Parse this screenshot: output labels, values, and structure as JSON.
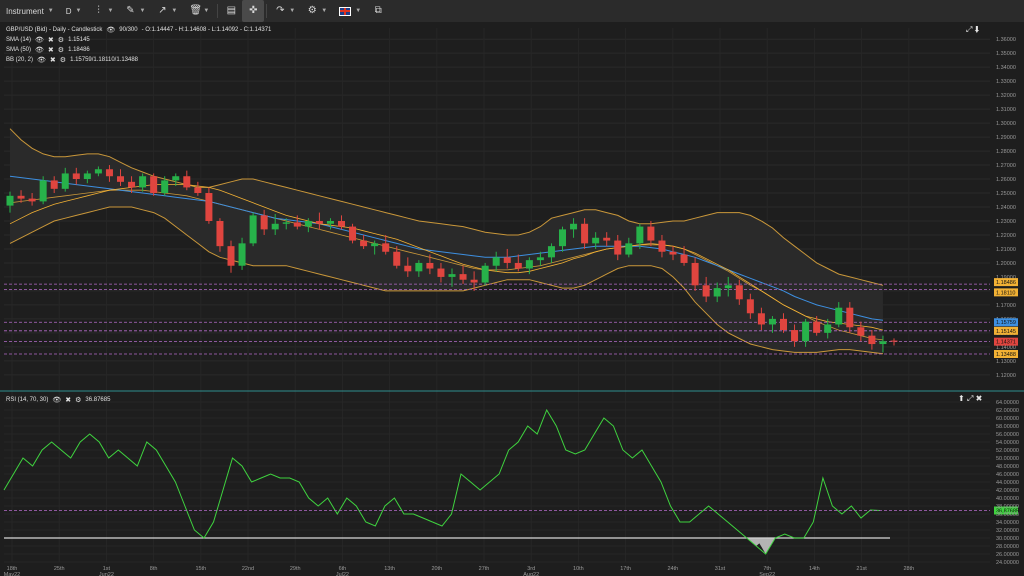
{
  "toolbar": {
    "instrument_label": "Instrument",
    "period_label": "D",
    "flag_icon": "uk-flag-icon"
  },
  "legend": {
    "title": "GBP/USD (Bid) - Daily - Candlestick",
    "candles_count": "90/300",
    "ohlc": "- O:1.14447 - H:1.14608 - L:1.14092 - C:1.14371",
    "sma14_label": "SMA (14)",
    "sma14_value": "1.15145",
    "sma50_label": "SMA (50)",
    "sma50_value": "1.18486",
    "bb_label": "BB (20, 2)",
    "bb_value": "1.15759/1.18110/1.13488",
    "rsi_label": "RSI (14, 70, 30)",
    "rsi_value": "36.87685"
  },
  "colors": {
    "bull": "#27b24a",
    "bear": "#e0453f",
    "sma14": "#f2b134",
    "sma50": "#3d8fe0",
    "bb": "#c9973a",
    "rsi": "#3fd33f",
    "background": "#1e1e1e"
  },
  "chart_data": [
    {
      "type": "candlestick",
      "x_labels": [
        "18th May22",
        "25th",
        "1st Jun22",
        "8th",
        "15th",
        "22nd",
        "29th",
        "6th Jul22",
        "13th",
        "20th",
        "27th",
        "3rd Aug22",
        "10th",
        "17th",
        "24th",
        "31st",
        "7th Sep22",
        "14th",
        "21st",
        "28th"
      ],
      "y_ticks": [
        "1.36000",
        "1.35000",
        "1.34000",
        "1.33000",
        "1.32000",
        "1.31000",
        "1.30000",
        "1.29000",
        "1.28000",
        "1.27000",
        "1.26000",
        "1.25000",
        "1.24000",
        "1.23000",
        "1.22000",
        "1.21000",
        "1.20000",
        "1.19000",
        "1.18000",
        "1.17000",
        "1.16000",
        "1.15000",
        "1.14000",
        "1.13000",
        "1.12000"
      ],
      "ylim": [
        1.112,
        1.368
      ],
      "price_tags": [
        {
          "label": "1.18486",
          "color": "#f2b134"
        },
        {
          "label": "1.18110",
          "color": "#f2b134"
        },
        {
          "label": "1.15759",
          "color": "#3d8fe0"
        },
        {
          "label": "1.15145",
          "color": "#f2b134"
        },
        {
          "label": "1.14371",
          "color": "#e0453f"
        },
        {
          "label": "1.13488",
          "color": "#f2b134"
        }
      ],
      "horizontal_levels": [
        1.18486,
        1.1811,
        1.15759,
        1.15145,
        1.14371,
        1.13488
      ],
      "candles": [
        [
          1.241,
          1.251,
          1.236,
          1.248
        ],
        [
          1.248,
          1.252,
          1.243,
          1.246
        ],
        [
          1.246,
          1.25,
          1.241,
          1.244
        ],
        [
          1.244,
          1.262,
          1.242,
          1.259
        ],
        [
          1.259,
          1.262,
          1.25,
          1.253
        ],
        [
          1.253,
          1.268,
          1.251,
          1.264
        ],
        [
          1.264,
          1.268,
          1.256,
          1.26
        ],
        [
          1.26,
          1.266,
          1.257,
          1.264
        ],
        [
          1.264,
          1.269,
          1.262,
          1.267
        ],
        [
          1.267,
          1.27,
          1.258,
          1.262
        ],
        [
          1.262,
          1.267,
          1.255,
          1.258
        ],
        [
          1.258,
          1.262,
          1.25,
          1.254
        ],
        [
          1.254,
          1.264,
          1.251,
          1.262
        ],
        [
          1.262,
          1.264,
          1.248,
          1.25
        ],
        [
          1.25,
          1.262,
          1.248,
          1.259
        ],
        [
          1.259,
          1.264,
          1.255,
          1.262
        ],
        [
          1.262,
          1.266,
          1.252,
          1.254
        ],
        [
          1.254,
          1.258,
          1.248,
          1.25
        ],
        [
          1.25,
          1.254,
          1.228,
          1.23
        ],
        [
          1.23,
          1.232,
          1.208,
          1.212
        ],
        [
          1.212,
          1.216,
          1.193,
          1.198
        ],
        [
          1.198,
          1.218,
          1.195,
          1.214
        ],
        [
          1.214,
          1.236,
          1.212,
          1.234
        ],
        [
          1.234,
          1.238,
          1.22,
          1.224
        ],
        [
          1.224,
          1.235,
          1.22,
          1.228
        ],
        [
          1.228,
          1.232,
          1.224,
          1.229
        ],
        [
          1.229,
          1.234,
          1.224,
          1.226
        ],
        [
          1.226,
          1.232,
          1.222,
          1.23
        ],
        [
          1.23,
          1.236,
          1.224,
          1.228
        ],
        [
          1.228,
          1.232,
          1.224,
          1.23
        ],
        [
          1.23,
          1.234,
          1.224,
          1.226
        ],
        [
          1.226,
          1.228,
          1.214,
          1.216
        ],
        [
          1.216,
          1.22,
          1.21,
          1.212
        ],
        [
          1.212,
          1.216,
          1.206,
          1.214
        ],
        [
          1.214,
          1.22,
          1.206,
          1.208
        ],
        [
          1.208,
          1.212,
          1.196,
          1.198
        ],
        [
          1.198,
          1.204,
          1.19,
          1.194
        ],
        [
          1.194,
          1.202,
          1.19,
          1.2
        ],
        [
          1.2,
          1.206,
          1.192,
          1.196
        ],
        [
          1.196,
          1.2,
          1.186,
          1.19
        ],
        [
          1.19,
          1.196,
          1.183,
          1.192
        ],
        [
          1.192,
          1.198,
          1.185,
          1.188
        ],
        [
          1.188,
          1.194,
          1.18,
          1.186
        ],
        [
          1.186,
          1.2,
          1.184,
          1.198
        ],
        [
          1.198,
          1.208,
          1.194,
          1.204
        ],
        [
          1.204,
          1.21,
          1.196,
          1.2
        ],
        [
          1.2,
          1.206,
          1.194,
          1.196
        ],
        [
          1.196,
          1.204,
          1.192,
          1.202
        ],
        [
          1.202,
          1.208,
          1.198,
          1.204
        ],
        [
          1.204,
          1.214,
          1.2,
          1.212
        ],
        [
          1.212,
          1.226,
          1.208,
          1.224
        ],
        [
          1.224,
          1.232,
          1.218,
          1.228
        ],
        [
          1.228,
          1.232,
          1.21,
          1.214
        ],
        [
          1.214,
          1.222,
          1.21,
          1.218
        ],
        [
          1.218,
          1.222,
          1.212,
          1.216
        ],
        [
          1.216,
          1.22,
          1.202,
          1.206
        ],
        [
          1.206,
          1.218,
          1.204,
          1.214
        ],
        [
          1.214,
          1.228,
          1.21,
          1.226
        ],
        [
          1.226,
          1.23,
          1.212,
          1.216
        ],
        [
          1.216,
          1.22,
          1.204,
          1.208
        ],
        [
          1.208,
          1.212,
          1.202,
          1.206
        ],
        [
          1.206,
          1.212,
          1.198,
          1.2
        ],
        [
          1.2,
          1.204,
          1.18,
          1.184
        ],
        [
          1.184,
          1.19,
          1.172,
          1.176
        ],
        [
          1.176,
          1.186,
          1.172,
          1.182
        ],
        [
          1.182,
          1.19,
          1.176,
          1.184
        ],
        [
          1.184,
          1.188,
          1.17,
          1.174
        ],
        [
          1.174,
          1.178,
          1.16,
          1.164
        ],
        [
          1.164,
          1.168,
          1.152,
          1.156
        ],
        [
          1.156,
          1.162,
          1.15,
          1.16
        ],
        [
          1.16,
          1.164,
          1.15,
          1.152
        ],
        [
          1.152,
          1.156,
          1.14,
          1.144
        ],
        [
          1.144,
          1.16,
          1.14,
          1.158
        ],
        [
          1.158,
          1.162,
          1.148,
          1.15
        ],
        [
          1.15,
          1.16,
          1.146,
          1.156
        ],
        [
          1.156,
          1.172,
          1.154,
          1.168
        ],
        [
          1.168,
          1.172,
          1.15,
          1.154
        ],
        [
          1.154,
          1.158,
          1.144,
          1.148
        ],
        [
          1.148,
          1.152,
          1.138,
          1.142
        ],
        [
          1.142,
          1.148,
          1.136,
          1.144
        ],
        [
          1.14447,
          1.14608,
          1.14092,
          1.14371
        ]
      ],
      "sma14": [
        1.228,
        1.232,
        1.236,
        1.239,
        1.242,
        1.244,
        1.246,
        1.248,
        1.25,
        1.252,
        1.253,
        1.254,
        1.255,
        1.256,
        1.256,
        1.256,
        1.256,
        1.255,
        1.254,
        1.252,
        1.249,
        1.246,
        1.243,
        1.24,
        1.237,
        1.234,
        1.232,
        1.23,
        1.228,
        1.227,
        1.226,
        1.225,
        1.223,
        1.221,
        1.219,
        1.217,
        1.214,
        1.211,
        1.208,
        1.205,
        1.202,
        1.199,
        1.197,
        1.195,
        1.194,
        1.193,
        1.193,
        1.194,
        1.196,
        1.198,
        1.2,
        1.203,
        1.205,
        1.208,
        1.21,
        1.211,
        1.212,
        1.213,
        1.213,
        1.213,
        1.212,
        1.21,
        1.207,
        1.203,
        1.199,
        1.195,
        1.19,
        1.185,
        1.18,
        1.175,
        1.17,
        1.166,
        1.162,
        1.16,
        1.158,
        1.157,
        1.156,
        1.155,
        1.154,
        1.152,
        1.15145
      ],
      "sma50": [
        1.262,
        1.261,
        1.26,
        1.259,
        1.258,
        1.257,
        1.256,
        1.255,
        1.254,
        1.253,
        1.252,
        1.251,
        1.25,
        1.249,
        1.248,
        1.247,
        1.246,
        1.245,
        1.244,
        1.242,
        1.24,
        1.238,
        1.236,
        1.234,
        1.232,
        1.231,
        1.23,
        1.229,
        1.228,
        1.226,
        1.224,
        1.222,
        1.22,
        1.218,
        1.216,
        1.214,
        1.212,
        1.21,
        1.209,
        1.208,
        1.207,
        1.206,
        1.205,
        1.204,
        1.204,
        1.204,
        1.205,
        1.206,
        1.207,
        1.208,
        1.209,
        1.21,
        1.211,
        1.212,
        1.212,
        1.212,
        1.212,
        1.212,
        1.211,
        1.21,
        1.208,
        1.206,
        1.204,
        1.201,
        1.198,
        1.195,
        1.192,
        1.189,
        1.186,
        1.183,
        1.18,
        1.176,
        1.173,
        1.17,
        1.168,
        1.166,
        1.164,
        1.162,
        1.16,
        1.159,
        1.15759
      ],
      "bb_upper": [
        1.296,
        1.288,
        1.282,
        1.278,
        1.276,
        1.276,
        1.277,
        1.278,
        1.278,
        1.276,
        1.272,
        1.268,
        1.265,
        1.262,
        1.26,
        1.258,
        1.256,
        1.254,
        1.254,
        1.256,
        1.258,
        1.26,
        1.26,
        1.258,
        1.256,
        1.254,
        1.252,
        1.25,
        1.248,
        1.246,
        1.244,
        1.242,
        1.24,
        1.238,
        1.236,
        1.234,
        1.232,
        1.23,
        1.229,
        1.228,
        1.227,
        1.226,
        1.224,
        1.222,
        1.221,
        1.22,
        1.22,
        1.222,
        1.226,
        1.232,
        1.234,
        1.236,
        1.238,
        1.238,
        1.236,
        1.234,
        1.23,
        1.228,
        1.228,
        1.229,
        1.23,
        1.23,
        1.232,
        1.234,
        1.236,
        1.236,
        1.236,
        1.234,
        1.23,
        1.225,
        1.218,
        1.212,
        1.206,
        1.2,
        1.196,
        1.192,
        1.19,
        1.188,
        1.186,
        1.184,
        1.18486
      ],
      "bb_middle": [
        1.243,
        1.244,
        1.245,
        1.246,
        1.247,
        1.248,
        1.249,
        1.25,
        1.251,
        1.252,
        1.252,
        1.252,
        1.252,
        1.251,
        1.25,
        1.249,
        1.248,
        1.246,
        1.244,
        1.242,
        1.24,
        1.238,
        1.236,
        1.234,
        1.232,
        1.23,
        1.228,
        1.226,
        1.224,
        1.222,
        1.22,
        1.218,
        1.216,
        1.214,
        1.212,
        1.21,
        1.208,
        1.206,
        1.204,
        1.202,
        1.2,
        1.198,
        1.196,
        1.195,
        1.195,
        1.195,
        1.196,
        1.197,
        1.198,
        1.2,
        1.202,
        1.204,
        1.206,
        1.208,
        1.21,
        1.211,
        1.212,
        1.213,
        1.214,
        1.213,
        1.212,
        1.21,
        1.206,
        1.202,
        1.198,
        1.194,
        1.189,
        1.184,
        1.18,
        1.175,
        1.17,
        1.166,
        1.162,
        1.158,
        1.155,
        1.152,
        1.15,
        1.148,
        1.146,
        1.145,
        1.1811
      ],
      "bb_lower": [
        1.214,
        1.218,
        1.222,
        1.226,
        1.23,
        1.232,
        1.234,
        1.236,
        1.238,
        1.24,
        1.24,
        1.24,
        1.238,
        1.236,
        1.232,
        1.226,
        1.22,
        1.214,
        1.208,
        1.204,
        1.202,
        1.2,
        1.198,
        1.198,
        1.198,
        1.198,
        1.196,
        1.194,
        1.192,
        1.19,
        1.188,
        1.186,
        1.184,
        1.182,
        1.18,
        1.18,
        1.18,
        1.18,
        1.18,
        1.18,
        1.18,
        1.18,
        1.182,
        1.184,
        1.186,
        1.188,
        1.188,
        1.188,
        1.186,
        1.184,
        1.182,
        1.182,
        1.184,
        1.188,
        1.192,
        1.196,
        1.198,
        1.198,
        1.198,
        1.196,
        1.19,
        1.182,
        1.172,
        1.164,
        1.156,
        1.15,
        1.146,
        1.142,
        1.14,
        1.138,
        1.137,
        1.136,
        1.136,
        1.136,
        1.137,
        1.138,
        1.138,
        1.137,
        1.136,
        1.135,
        1.13488
      ]
    },
    {
      "type": "line",
      "name": "RSI (14, 70, 30)",
      "y_ticks": [
        "64.00000",
        "62.00000",
        "60.00000",
        "58.00000",
        "56.00000",
        "54.00000",
        "52.00000",
        "50.00000",
        "48.00000",
        "46.00000",
        "44.00000",
        "42.00000",
        "40.00000",
        "38.00000",
        "36.00000",
        "34.00000",
        "32.00000",
        "30.00000",
        "28.00000",
        "26.00000",
        "24.00000"
      ],
      "ylim": [
        24,
        65
      ],
      "oversold_level": 30,
      "current_tag": "36.87685",
      "values": [
        42,
        46,
        50,
        48,
        52,
        54,
        52,
        50,
        54,
        56,
        54,
        50,
        52,
        50,
        48,
        54,
        52,
        48,
        44,
        38,
        32,
        30,
        34,
        42,
        50,
        48,
        44,
        45,
        46,
        45,
        45,
        44,
        40,
        38,
        40,
        36,
        40,
        38,
        34,
        33,
        38,
        40,
        36,
        36,
        35,
        34,
        33,
        36,
        46,
        44,
        42,
        44,
        46,
        52,
        54,
        58,
        56,
        62,
        58,
        52,
        51,
        52,
        56,
        60,
        58,
        52,
        50,
        52,
        48,
        44,
        38,
        34,
        34,
        36,
        38,
        36,
        34,
        32,
        30,
        28,
        26,
        30,
        31,
        30,
        30,
        34,
        45,
        38,
        36,
        38,
        35,
        37,
        36.87685
      ]
    }
  ]
}
